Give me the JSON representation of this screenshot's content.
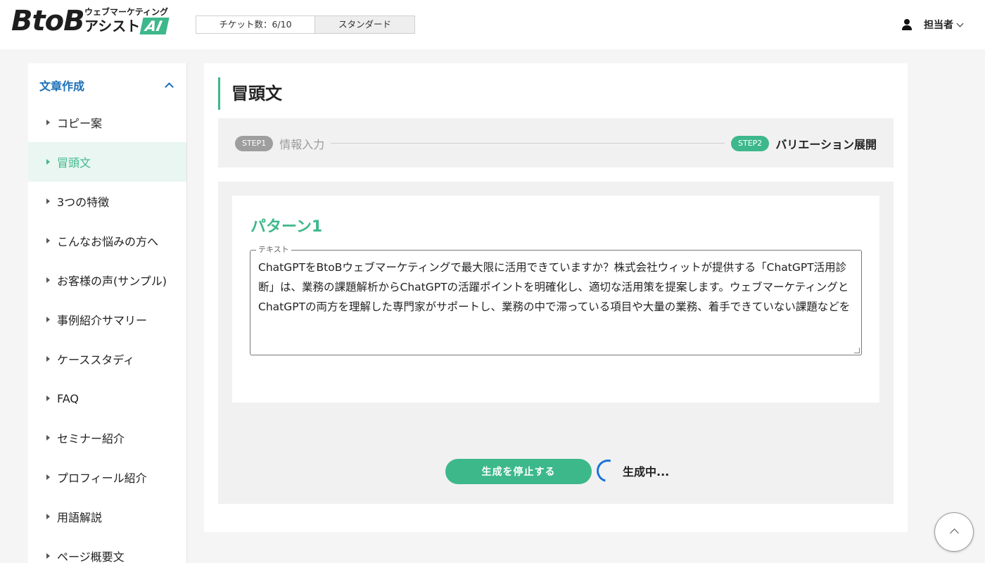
{
  "header": {
    "logo_main": "BtoB",
    "logo_sub": "ウェブマーケティング",
    "logo_assist": "アシスト",
    "logo_ai": "AI",
    "ticket_count": "チケット数：6/10",
    "plan": "スタンダード",
    "user_name": "担当者",
    "icons": {
      "user": "user-icon",
      "dropdown": "chevron-down-icon"
    }
  },
  "sidebar": {
    "section_label": "文章作成",
    "section_icon": "chevron-up-icon",
    "items": [
      {
        "label": "コピー案",
        "active": false
      },
      {
        "label": "冒頭文",
        "active": true
      },
      {
        "label": "3つの特徴",
        "active": false
      },
      {
        "label": "こんなお悩みの方へ",
        "active": false
      },
      {
        "label": "お客様の声(サンプル)",
        "active": false
      },
      {
        "label": "事例紹介サマリー",
        "active": false
      },
      {
        "label": "ケーススタディ",
        "active": false
      },
      {
        "label": "FAQ",
        "active": false
      },
      {
        "label": "セミナー紹介",
        "active": false
      },
      {
        "label": "プロフィール紹介",
        "active": false
      },
      {
        "label": "用語解説",
        "active": false
      },
      {
        "label": "ページ概要文",
        "active": false
      }
    ]
  },
  "main": {
    "title": "冒頭文",
    "steps": {
      "step1_badge": "STEP1",
      "step1_label": "情報入力",
      "step2_badge": "STEP2",
      "step2_label": "バリエーション展開"
    },
    "pattern": {
      "title": "パターン1",
      "field_label": "テキスト",
      "text": "ChatGPTをBtoBウェブマーケティングで最大限に活用できていますか？株式会社ウィットが提供する「ChatGPT活用診断」は、業務の課題解析からChatGPTの活躍ポイントを明確化し、適切な活用策を提案します。ウェブマーケティングとChatGPTの両方を理解した専門家がサポートし、業務の中で滞っている項目や大量の業務、着手できていない課題などを"
    },
    "stop_button": "生成を停止する",
    "status": "生成中..."
  },
  "colors": {
    "accent": "#3db88b",
    "link": "#1a6fb8",
    "spinner": "#1a73d9",
    "active_bg": "#e9f6f1"
  }
}
